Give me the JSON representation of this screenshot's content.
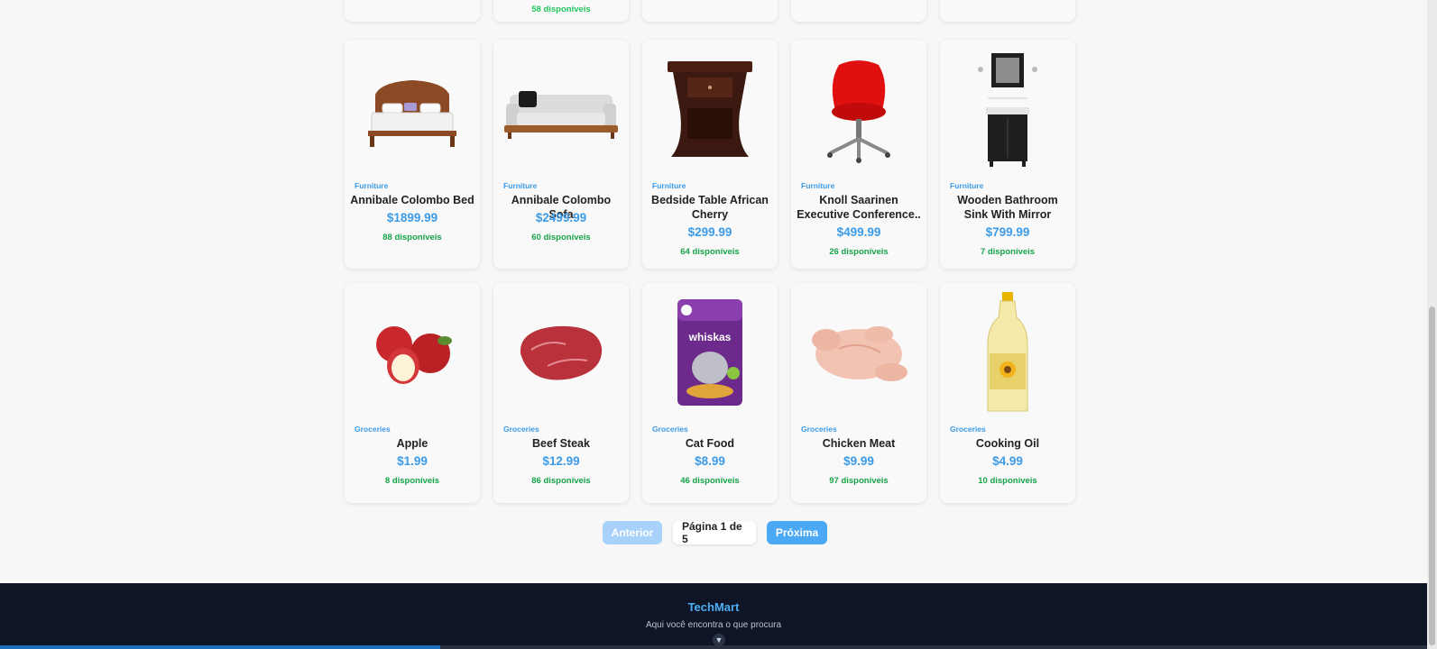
{
  "top_row": {
    "stock_label": "58 disponíveis"
  },
  "products": [
    {
      "category": "Furniture",
      "title": "Annibale Colombo Bed",
      "price": "$1899.99",
      "stock": "88 disponíveis",
      "icon": "bed-icon"
    },
    {
      "category": "Furniture",
      "title": "Annibale Colombo Sofa",
      "price": "$2499.99",
      "stock": "60 disponíveis",
      "icon": "sofa-icon"
    },
    {
      "category": "Furniture",
      "title": "Bedside Table African Cherry",
      "price": "$299.99",
      "stock": "64 disponíveis",
      "icon": "bedside-table-icon"
    },
    {
      "category": "Furniture",
      "title": "Knoll Saarinen Executive Conference..",
      "price": "$499.99",
      "stock": "26 disponíveis",
      "icon": "office-chair-icon"
    },
    {
      "category": "Furniture",
      "title": "Wooden Bathroom Sink With Mirror",
      "price": "$799.99",
      "stock": "7 disponíveis",
      "icon": "bathroom-sink-icon"
    },
    {
      "category": "Groceries",
      "title": "Apple",
      "price": "$1.99",
      "stock": "8 disponíveis",
      "icon": "apple-icon"
    },
    {
      "category": "Groceries",
      "title": "Beef Steak",
      "price": "$12.99",
      "stock": "86 disponíveis",
      "icon": "steak-icon"
    },
    {
      "category": "Groceries",
      "title": "Cat Food",
      "price": "$8.99",
      "stock": "46 disponíveis",
      "icon": "cat-food-icon"
    },
    {
      "category": "Groceries",
      "title": "Chicken Meat",
      "price": "$9.99",
      "stock": "97 disponíveis",
      "icon": "chicken-icon"
    },
    {
      "category": "Groceries",
      "title": "Cooking Oil",
      "price": "$4.99",
      "stock": "10 disponíveis",
      "icon": "oil-bottle-icon"
    }
  ],
  "pagination": {
    "prev_label": "Anterior",
    "page_label": "Página 1 de 5",
    "next_label": "Próxima"
  },
  "footer": {
    "brand": "TechMart",
    "tagline": "Aqui você encontra o que procura"
  },
  "colors": {
    "accent": "#3b9be8",
    "stock_green": "#16a34a",
    "footer_bg": "#0d1527"
  }
}
